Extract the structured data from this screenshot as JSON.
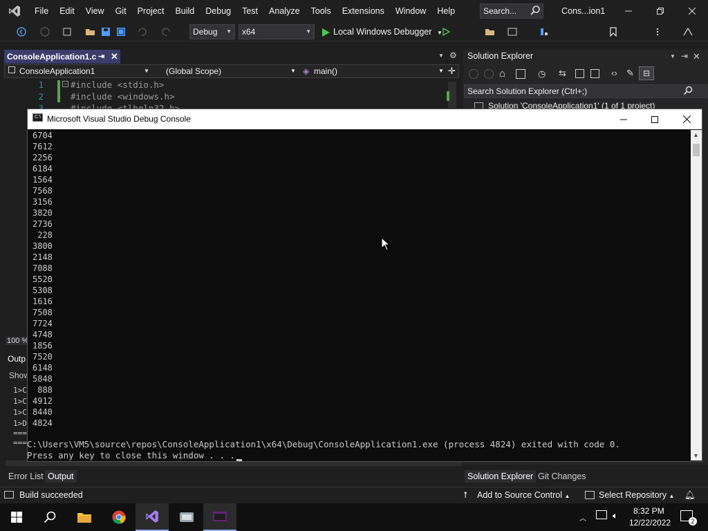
{
  "menubar": {
    "items": [
      "File",
      "Edit",
      "View",
      "Git",
      "Project",
      "Build",
      "Debug",
      "Test",
      "Analyze",
      "Tools",
      "Extensions",
      "Window",
      "Help"
    ],
    "search_label": "Search...",
    "window_title": "Cons...ion1"
  },
  "toolbar": {
    "config": "Debug",
    "platform": "x64",
    "run_label": "Local Windows Debugger"
  },
  "editor": {
    "tab_label": "ConsoleApplication1.c",
    "project_combo": "ConsoleApplication1",
    "scope_combo": "(Global Scope)",
    "member_combo": "main()",
    "lines": [
      {
        "num": "1",
        "text": "#include <stdio.h>"
      },
      {
        "num": "2",
        "text": "#include <windows.h>"
      },
      {
        "num": "3",
        "text": "#include <tlhelp32.h>"
      }
    ],
    "zoom": "100 %",
    "output_label": "Outp",
    "show_label": "Show",
    "output_lines": [
      "1>C",
      "1>C",
      "1>C",
      "1>D",
      "===",
      "==="
    ]
  },
  "solution_explorer": {
    "title": "Solution Explorer",
    "search_placeholder": "Search Solution Explorer (Ctrl+;)",
    "solution_label": "Solution 'ConsoleApplication1' (1 of 1 project)"
  },
  "console": {
    "title": "Microsoft Visual Studio Debug Console",
    "numbers": [
      "6704",
      "7612",
      "2256",
      "6184",
      "1564",
      "7568",
      "3156",
      "3820",
      "2736",
      " 228",
      "3800",
      "2148",
      "7088",
      "5520",
      "5308",
      "1616",
      "7508",
      "7724",
      "4748",
      "1856",
      "7520",
      "6148",
      "5848",
      " 888",
      "4912",
      "8440",
      "4824"
    ],
    "exit_line": "C:\\Users\\VM5\\source\\repos\\ConsoleApplication1\\x64\\Debug\\ConsoleApplication1.exe (process 4824) exited with code 0.",
    "press_line": "Press any key to close this window . . ."
  },
  "bottom_tabs": {
    "error_list": "Error List",
    "output": "Output",
    "solution_explorer": "Solution Explorer",
    "git_changes": "Git Changes"
  },
  "statusbar": {
    "build_status": "Build succeeded",
    "source_control": "Add to Source Control",
    "repository": "Select Repository",
    "notification_count": "2"
  },
  "taskbar": {
    "time": "8:32 PM",
    "date": "12/22/2022"
  },
  "colors": {
    "accent": "#3a3d6b",
    "vs_purple": "#68217a",
    "run_green": "#4ec94e",
    "console_bg": "#0c0c0c"
  }
}
